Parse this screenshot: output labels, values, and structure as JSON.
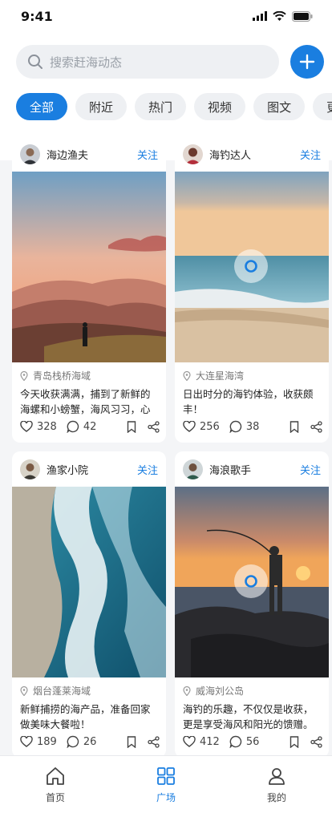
{
  "status_bar": {
    "time": "9:41"
  },
  "search": {
    "placeholder": "搜索赶海动态"
  },
  "tabs": [
    "全部",
    "附近",
    "热门",
    "视频",
    "图文",
    "更"
  ],
  "posts": [
    {
      "user": "海边渔夫",
      "follow": "关注",
      "location": "青岛栈桥海域",
      "text": "今天收获满满，捕到了新鲜的海螺和小螃蟹，海风习习，心",
      "likes": "328",
      "comments": "42",
      "is_video": false
    },
    {
      "user": "海钓达人",
      "follow": "关注",
      "location": "大连星海湾",
      "text": "日出时分的海钓体验，收获颇丰！",
      "likes": "256",
      "comments": "38",
      "is_video": true
    },
    {
      "user": "渔家小院",
      "follow": "关注",
      "location": "烟台蓬莱海域",
      "text": "新鲜捕捞的海产品，准备回家做美味大餐啦！",
      "likes": "189",
      "comments": "26",
      "is_video": false
    },
    {
      "user": "海浪歌手",
      "follow": "关注",
      "location": "威海刘公岛",
      "text": "海钓的乐趣，不仅仅是收获，更是享受海风和阳光的馈赠。",
      "likes": "412",
      "comments": "56",
      "is_video": true
    }
  ],
  "bottom_nav": [
    {
      "label": "首页",
      "icon": "home-icon"
    },
    {
      "label": "广场",
      "icon": "grid-icon",
      "active": true
    },
    {
      "label": "我的",
      "icon": "user-icon"
    }
  ],
  "colors": {
    "accent": "#1a7ee0",
    "background": "#f4f5f7"
  }
}
